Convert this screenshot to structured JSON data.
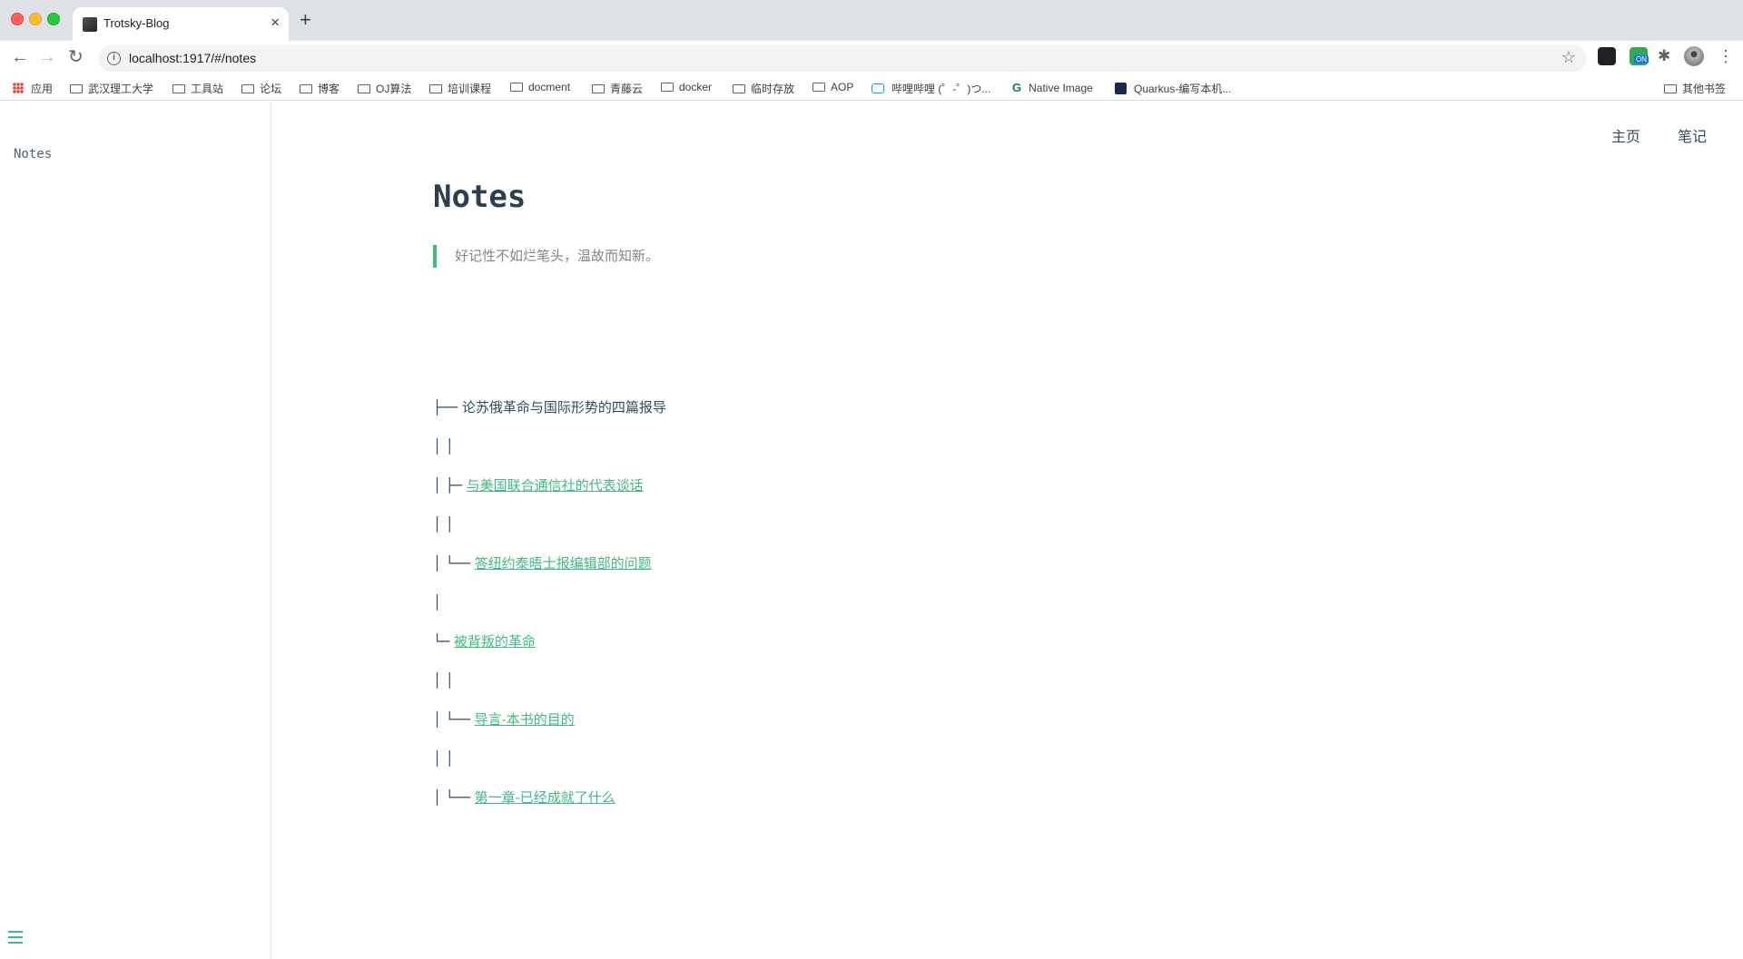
{
  "browser": {
    "tab_title": "Trotsky-Blog",
    "tab_close": "×",
    "new_tab": "+",
    "url": "localhost:1917/#/notes",
    "back": "←",
    "forward": "→",
    "reload": "↻",
    "info": "i",
    "star": "☆",
    "ext_badge": "ON",
    "puzzle": "✱",
    "menu": "⋮"
  },
  "bookmarks": {
    "apps": "应用",
    "items": [
      "武汉理工大学",
      "工具站",
      "论坛",
      "博客",
      "OJ算法",
      "培训课程",
      "docment",
      "青藤云",
      "docker",
      "临时存放",
      "AOP"
    ],
    "bilibili": "哔哩哔哩 (゜-゜)つ...",
    "native_image": "Native Image",
    "quarkus": "Quarkus-编写本机...",
    "other": "其他书签"
  },
  "sidebar": {
    "items": [
      {
        "label": "Notes"
      }
    ]
  },
  "nav": {
    "home": "主页",
    "notes": "笔记"
  },
  "main": {
    "title": "Notes",
    "quote": "好记性不如烂笔头，温故而知新。",
    "tree": [
      {
        "prefix": "├── ",
        "text": "论苏俄革命与国际形势的四篇报导",
        "link": false
      },
      {
        "prefix": "│ │",
        "text": "",
        "link": false
      },
      {
        "prefix": "│ ├─ ",
        "text": "与美国联合通信社的代表谈话",
        "link": true
      },
      {
        "prefix": "│ │",
        "text": "",
        "link": false
      },
      {
        "prefix": "│ └── ",
        "text": "答纽约泰晤士报编辑部的问题",
        "link": true
      },
      {
        "prefix": "│",
        "text": "",
        "link": false
      },
      {
        "prefix": "└─ ",
        "text": "被背叛的革命",
        "link": true
      },
      {
        "prefix": "│ │",
        "text": "",
        "link": false
      },
      {
        "prefix": "│ └── ",
        "text": "导言-本书的目的",
        "link": true
      },
      {
        "prefix": "│ │",
        "text": "",
        "link": false
      },
      {
        "prefix": "│ └── ",
        "text": "第一章-已经成就了什么",
        "link": true
      }
    ]
  },
  "colors": {
    "accent": "#42b983",
    "text": "#34495e",
    "heading": "#2c3e50"
  }
}
